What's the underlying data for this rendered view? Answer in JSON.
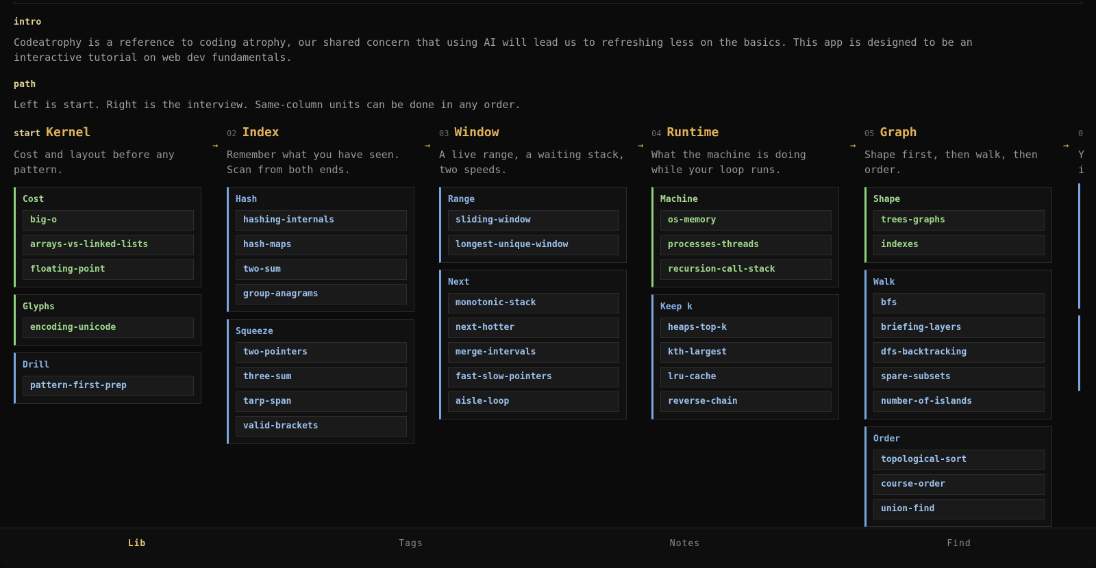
{
  "intro": {
    "label": "intro",
    "text": "Codeatrophy is a reference to coding atrophy, our shared concern that using AI will lead us to refreshing less on the basics. This app is designed to be an interactive tutorial on web dev fundamentals."
  },
  "path": {
    "label": "path",
    "text": "Left is start. Right is the interview. Same-column units can be done in any order."
  },
  "arrow_glyph": "→",
  "columns": [
    {
      "num": "start",
      "title": "Kernel",
      "desc_lines": [
        "Cost and layout before any",
        "pattern."
      ],
      "groups": [
        {
          "title": "Cost",
          "color": "green",
          "items": [
            "big-o",
            "arrays-vs-linked-lists",
            "floating-point"
          ]
        },
        {
          "title": "Glyphs",
          "color": "green",
          "items": [
            "encoding-unicode"
          ]
        },
        {
          "title": "Drill",
          "color": "blue",
          "items": [
            "pattern-first-prep"
          ]
        }
      ]
    },
    {
      "num": "02",
      "title": "Index",
      "desc_lines": [
        "Remember what you have seen.",
        "Scan from both ends."
      ],
      "groups": [
        {
          "title": "Hash",
          "color": "blue",
          "items": [
            "hashing-internals",
            "hash-maps",
            "two-sum",
            "group-anagrams"
          ]
        },
        {
          "title": "Squeeze",
          "color": "blue",
          "items": [
            "two-pointers",
            "three-sum",
            "tarp-span",
            "valid-brackets"
          ]
        }
      ]
    },
    {
      "num": "03",
      "title": "Window",
      "desc_lines": [
        "A live range, a waiting stack,",
        "two speeds."
      ],
      "groups": [
        {
          "title": "Range",
          "color": "blue",
          "items": [
            "sliding-window",
            "longest-unique-window"
          ]
        },
        {
          "title": "Next",
          "color": "blue",
          "items": [
            "monotonic-stack",
            "next-hotter",
            "merge-intervals",
            "fast-slow-pointers",
            "aisle-loop"
          ]
        }
      ]
    },
    {
      "num": "04",
      "title": "Runtime",
      "desc_lines": [
        "What the machine is doing",
        "while your loop runs."
      ],
      "groups": [
        {
          "title": "Machine",
          "color": "green",
          "items": [
            "os-memory",
            "processes-threads",
            "recursion-call-stack"
          ]
        },
        {
          "title": "Keep k",
          "color": "blue",
          "items": [
            "heaps-top-k",
            "kth-largest",
            "lru-cache",
            "reverse-chain"
          ]
        }
      ]
    },
    {
      "num": "05",
      "title": "Graph",
      "desc_lines": [
        "Shape first, then walk, then",
        "order."
      ],
      "groups": [
        {
          "title": "Shape",
          "color": "green",
          "items": [
            "trees-graphs",
            "indexes"
          ]
        },
        {
          "title": "Walk",
          "color": "blue",
          "items": [
            "bfs",
            "briefing-layers",
            "dfs-backtracking",
            "spare-subsets",
            "number-of-islands"
          ]
        },
        {
          "title": "Order",
          "color": "blue",
          "items": [
            "topological-sort",
            "course-order",
            "union-find"
          ]
        }
      ]
    }
  ],
  "next_column_peek": {
    "num": "0",
    "desc_lines": [
      "Y",
      "i"
    ]
  },
  "nav": [
    "Lib",
    "Tags",
    "Notes",
    "Find"
  ],
  "colors": {
    "accent": "#e2b35c",
    "green": "#8ed27c",
    "blue": "#7aa7e0",
    "background": "#0b0b0b"
  }
}
